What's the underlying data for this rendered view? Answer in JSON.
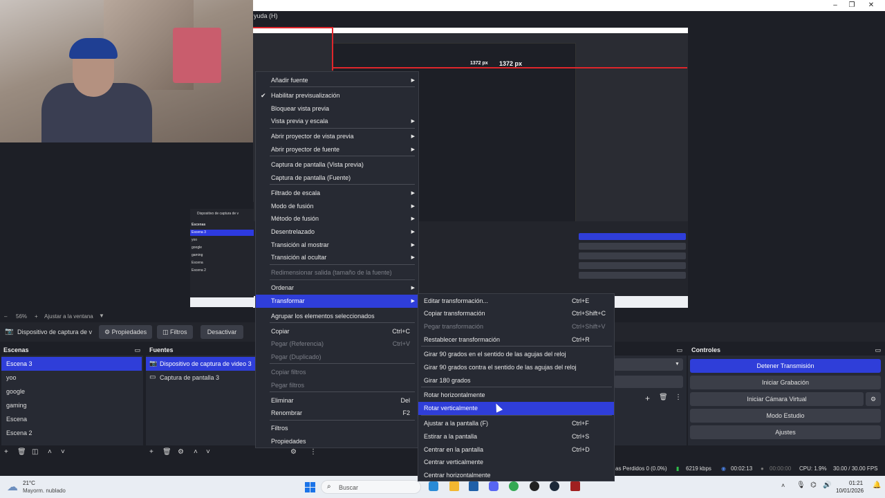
{
  "menubar": {
    "help": "yuda (H)"
  },
  "window": {
    "minimize": "–",
    "maximize": "❐",
    "close": "✕"
  },
  "preview": {
    "measure_label_1": "1372 px",
    "measure_label_2": "1372 px"
  },
  "mini_scenes": {
    "header": "Escenas",
    "items": [
      "Escena 3",
      "yoo",
      "google",
      "gaming",
      "Escena",
      "Escena 2"
    ],
    "source_label": "Dispositivo de captura de v"
  },
  "zoom": {
    "level": "56%",
    "fit": "Ajustar a la ventana"
  },
  "source_toolbar": {
    "source_name": "Dispositivo de captura de v",
    "properties": "Propiedades",
    "filters": "Filtros",
    "deactivate": "Desactivar"
  },
  "scenes": {
    "title": "Escenas",
    "items": [
      "Escena 3",
      "yoo",
      "google",
      "gaming",
      "Escena",
      "Escena 2"
    ],
    "selected": 0
  },
  "sources": {
    "title": "Fuentes",
    "items": [
      "Dispositivo de captura de video 3",
      "Captura de pantalla 3"
    ]
  },
  "controls": {
    "title": "Controles",
    "buttons": [
      "Detener Transmisión",
      "Iniciar Grabación",
      "Iniciar Cámara Virtual",
      "Modo Estudio",
      "Ajustes"
    ]
  },
  "context_menu": {
    "items": [
      {
        "label": "Añadir fuente",
        "submenu": true
      },
      {
        "label": "Habilitar previsualización",
        "checked": true
      },
      {
        "label": "Bloquear vista previa"
      },
      {
        "label": "Vista previa y escala",
        "submenu": true
      },
      {
        "label": "Abrir proyector de vista previa",
        "submenu": true
      },
      {
        "label": "Abrir proyector de fuente",
        "submenu": true
      },
      {
        "label": "Captura de pantalla (Vista previa)"
      },
      {
        "label": "Captura de pantalla (Fuente)"
      },
      {
        "label": "Filtrado de escala",
        "submenu": true
      },
      {
        "label": "Modo de fusión",
        "submenu": true
      },
      {
        "label": "Método de fusión",
        "submenu": true
      },
      {
        "label": "Desentrelazado",
        "submenu": true
      },
      {
        "label": "Transición al mostrar",
        "submenu": true
      },
      {
        "label": "Transición al ocultar",
        "submenu": true
      },
      {
        "label": "Redimensionar salida (tamaño de la fuente)",
        "disabled": true
      },
      {
        "label": "Ordenar",
        "submenu": true
      },
      {
        "label": "Transformar",
        "submenu": true,
        "highlighted": true
      },
      {
        "label": "Agrupar los elementos seleccionados"
      },
      {
        "label": "Copiar",
        "shortcut": "Ctrl+C"
      },
      {
        "label": "Pegar (Referencia)",
        "shortcut": "Ctrl+V",
        "disabled": true
      },
      {
        "label": "Pegar (Duplicado)",
        "disabled": true
      },
      {
        "label": "Copiar filtros",
        "disabled": true
      },
      {
        "label": "Pegar filtros",
        "disabled": true
      },
      {
        "label": "Eliminar",
        "shortcut": "Del"
      },
      {
        "label": "Renombrar",
        "shortcut": "F2"
      },
      {
        "label": "Filtros"
      },
      {
        "label": "Propiedades"
      }
    ]
  },
  "transform_menu": {
    "items": [
      {
        "label": "Editar transformación...",
        "shortcut": "Ctrl+E"
      },
      {
        "label": "Copiar transformación",
        "shortcut": "Ctrl+Shift+C"
      },
      {
        "label": "Pegar transformación",
        "shortcut": "Ctrl+Shift+V",
        "disabled": true
      },
      {
        "label": "Restablecer transformación",
        "shortcut": "Ctrl+R"
      },
      {
        "label": "Girar 90 grados en el sentido de las agujas del reloj"
      },
      {
        "label": "Girar 90 grados contra el sentido de las agujas del reloj"
      },
      {
        "label": "Girar 180 grados"
      },
      {
        "label": "Rotar horizontalmente"
      },
      {
        "label": "Rotar verticalmente",
        "highlighted": true
      },
      {
        "label": "Ajustar a la pantalla (F)",
        "shortcut": "Ctrl+F"
      },
      {
        "label": "Estirar a la pantalla",
        "shortcut": "Ctrl+S"
      },
      {
        "label": "Centrar en la pantalla",
        "shortcut": "Ctrl+D"
      },
      {
        "label": "Centrar verticalmente"
      },
      {
        "label": "Centrar horizontalmente"
      }
    ]
  },
  "status": {
    "dropped": "as Perdidos 0 (0.0%)",
    "bitrate": "6219 kbps",
    "stream_time": "00:02:13",
    "rec_time": "00:00:00",
    "cpu": "CPU: 1.9%",
    "fps": "30.00 / 30.00 FPS"
  },
  "taskbar": {
    "weather_temp": "21°C",
    "weather_desc": "Mayorm. nublado",
    "search": "Buscar",
    "time": "01:21",
    "date": "10/01/2026"
  },
  "colors": {
    "accent": "#2f3ed9",
    "panel": "#272a33",
    "bg": "#1d1f26"
  }
}
